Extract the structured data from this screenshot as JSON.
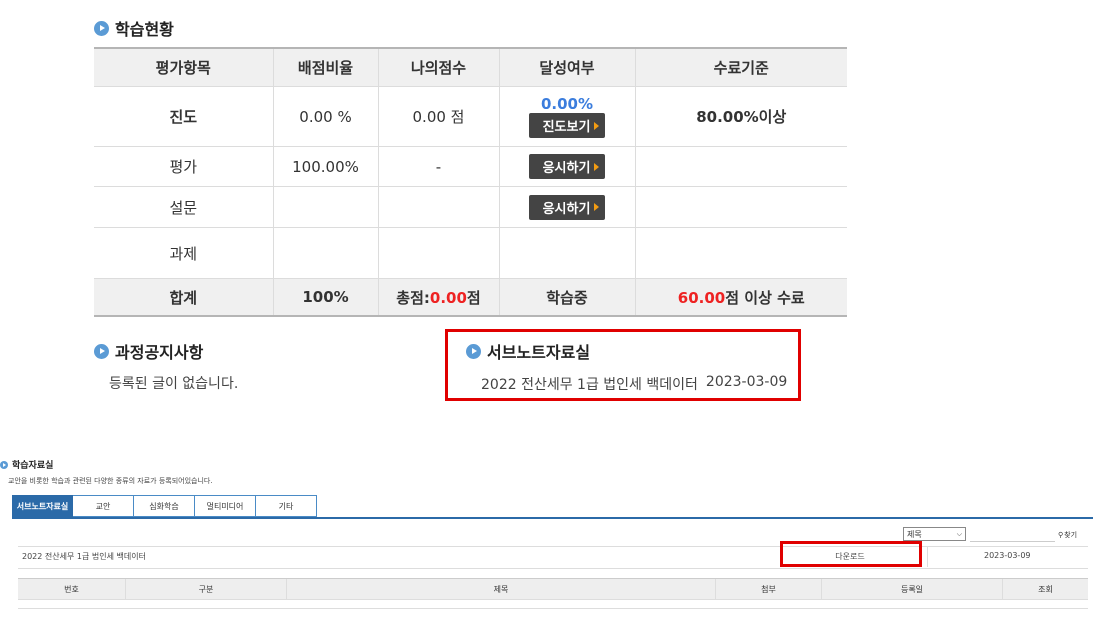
{
  "status_section": {
    "title": "학습현황"
  },
  "grade_table": {
    "headers": [
      "평가항목",
      "배점비율",
      "나의점수",
      "달성여부",
      "수료기준"
    ],
    "progress": {
      "label": "진도",
      "ratio": "0.00 %",
      "score": "0.00 점",
      "achieved": "0.00%",
      "button": "진도보기",
      "criteria": "80.00%이상"
    },
    "evaluation": {
      "label": "평가",
      "ratio": "100.00%",
      "score": "-",
      "button": "응시하기"
    },
    "survey": {
      "label": "설문",
      "button": "응시하기"
    },
    "assignment": {
      "label": "과제"
    },
    "total": {
      "label": "합계",
      "ratio": "100%",
      "score_prefix": "총점:",
      "score_value": "0.00",
      "score_suffix": "점",
      "status": "학습중",
      "criteria_value": "60.00",
      "criteria_suffix": "점 이상 수료"
    }
  },
  "notice": {
    "title": "과정공지사항",
    "empty": "등록된 글이 없습니다."
  },
  "subnote": {
    "title": "서브노트자료실",
    "item": "2022 전산세무 1급 법인세 백데이터",
    "date": "2023-03-09"
  },
  "library": {
    "title": "학습자료실",
    "description": "교안을 비롯한 학습과 관련된 다양한 종류의 자료가 등록되어있습니다.",
    "tabs": [
      "서브노트자료실",
      "교안",
      "심화학습",
      "멀티미디어",
      "기타"
    ],
    "search_select": "제목",
    "search_button": "찾기",
    "row": {
      "title": "2022 전산세무 1급 법인세 백데이터",
      "download": "다운로드",
      "date": "2023-03-09"
    },
    "columns": [
      "번호",
      "구분",
      "제목",
      "첨부",
      "등록일",
      "조회"
    ]
  },
  "colors": {
    "accent": "#2b6aa8",
    "highlight": "#e00000",
    "progress_blue": "#3b7ddd",
    "score_red": "#e22222"
  }
}
